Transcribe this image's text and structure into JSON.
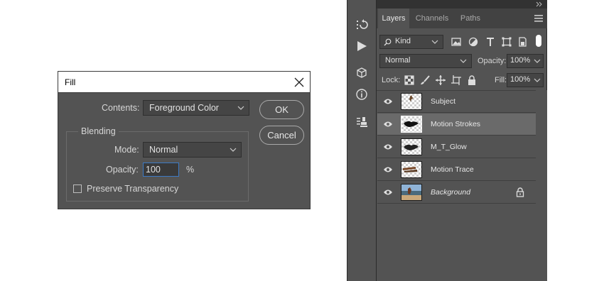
{
  "fill_dialog": {
    "title": "Fill",
    "contents_label": "Contents:",
    "contents_value": "Foreground Color",
    "ok_label": "OK",
    "cancel_label": "Cancel",
    "blending_title": "Blending",
    "mode_label": "Mode:",
    "mode_value": "Normal",
    "opacity_label": "Opacity:",
    "opacity_value": "100",
    "opacity_unit": "%",
    "preserve_label": "Preserve Transparency"
  },
  "layers_panel": {
    "tabs": [
      {
        "label": "Layers",
        "active": true
      },
      {
        "label": "Channels",
        "active": false
      },
      {
        "label": "Paths",
        "active": false
      }
    ],
    "filter_value": "Kind",
    "blend_mode": "Normal",
    "opacity_label": "Opacity:",
    "opacity_value": "100%",
    "lock_label": "Lock:",
    "fill_label": "Fill:",
    "fill_value": "100%",
    "layers": [
      {
        "name": "Subject",
        "selected": false,
        "thumb": "subject"
      },
      {
        "name": "Motion Strokes",
        "selected": true,
        "thumb": "strokes"
      },
      {
        "name": "M_T_Glow",
        "selected": false,
        "thumb": "glow"
      },
      {
        "name": "Motion Trace",
        "selected": false,
        "thumb": "trace"
      },
      {
        "name": "Background",
        "selected": false,
        "thumb": "photo",
        "locked": true,
        "italic": true
      }
    ]
  },
  "colors": {
    "panel_bg": "#535353",
    "dark_bar": "#424242",
    "selected_row": "#6a6a6a",
    "focus_border": "#3d7ac4"
  }
}
